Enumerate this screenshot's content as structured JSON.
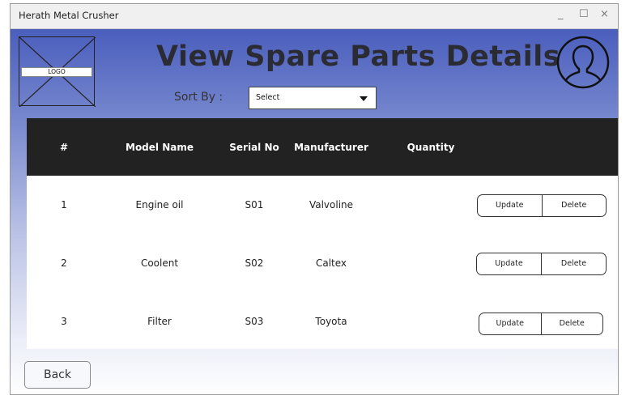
{
  "window": {
    "title": "Herath Metal Crusher",
    "minimize": "_",
    "maximize": "☐",
    "close": "×"
  },
  "header": {
    "logo_label": "LOGO",
    "title": "View Spare Parts Details",
    "avatar_icon": "user-avatar-icon"
  },
  "sort": {
    "label": "Sort By :",
    "selected": "Select"
  },
  "table": {
    "columns": [
      "#",
      "Model Name",
      "Serial No",
      "Manufacturer",
      "Quantity"
    ],
    "rows": [
      {
        "num": "1",
        "model": "Engine oil",
        "serial": "S01",
        "manufacturer": "Valvoline",
        "quantity": "",
        "update": "Update",
        "delete": "Delete"
      },
      {
        "num": "2",
        "model": "Coolent",
        "serial": "S02",
        "manufacturer": "Caltex",
        "quantity": "",
        "update": "Update",
        "delete": "Delete"
      },
      {
        "num": "3",
        "model": "Filter",
        "serial": "S03",
        "manufacturer": "Toyota",
        "quantity": "",
        "update": "Update",
        "delete": "Delete"
      }
    ]
  },
  "footer": {
    "back_label": "Back"
  }
}
